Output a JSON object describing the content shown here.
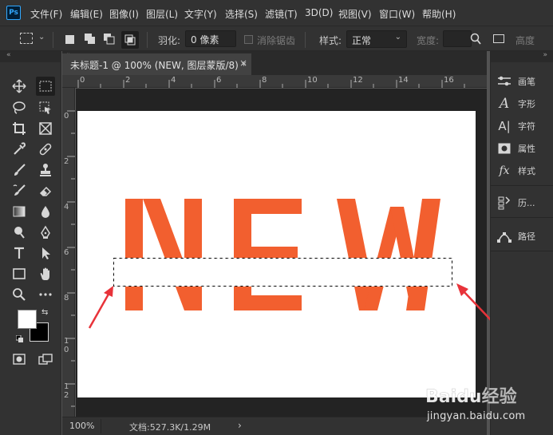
{
  "app": {
    "logo_text": "Ps",
    "menu": [
      "文件(F)",
      "编辑(E)",
      "图像(I)",
      "图层(L)",
      "文字(Y)",
      "选择(S)",
      "滤镜(T)",
      "3D(D)",
      "视图(V)",
      "窗口(W)",
      "帮助(H)"
    ]
  },
  "options": {
    "feather_label": "羽化:",
    "feather_value": "0 像素",
    "antialias_label": "消除锯齿",
    "style_label": "样式:",
    "style_value": "正常",
    "width_label": "宽度:",
    "height_label": "高度"
  },
  "document": {
    "tab_title": "未标题-1 @ 100% (NEW, 图层蒙版/8) *",
    "close_glyph": "×",
    "canvas_text": "NEW",
    "text_color": "#f25f2f",
    "zoom": "100%",
    "doc_info": "文档:527.3K/1.29M",
    "status_chevron": "›"
  },
  "rulers": {
    "horizontal": [
      "0",
      "2",
      "4",
      "6",
      "8",
      "10",
      "12",
      "14",
      "16"
    ],
    "vertical": [
      "0",
      "2",
      "4",
      "6",
      "8",
      "1\n0",
      "1\n2"
    ]
  },
  "panels": [
    {
      "label": "画笔",
      "icon": "brush-settings-icon"
    },
    {
      "label": "字形",
      "icon": "glyphs-icon"
    },
    {
      "label": "字符",
      "icon": "character-icon"
    },
    {
      "label": "属性",
      "icon": "properties-icon"
    },
    {
      "label": "样式",
      "icon": "styles-icon"
    },
    {
      "label": "历...",
      "icon": "history-icon"
    },
    {
      "label": "路径",
      "icon": "paths-icon"
    }
  ],
  "colors": {
    "foreground": "#ffffff",
    "background": "#000000",
    "accent_arrow": "#e8333a"
  },
  "watermark": {
    "brand": "Baidu经验",
    "url": "jingyan.baidu.com"
  }
}
